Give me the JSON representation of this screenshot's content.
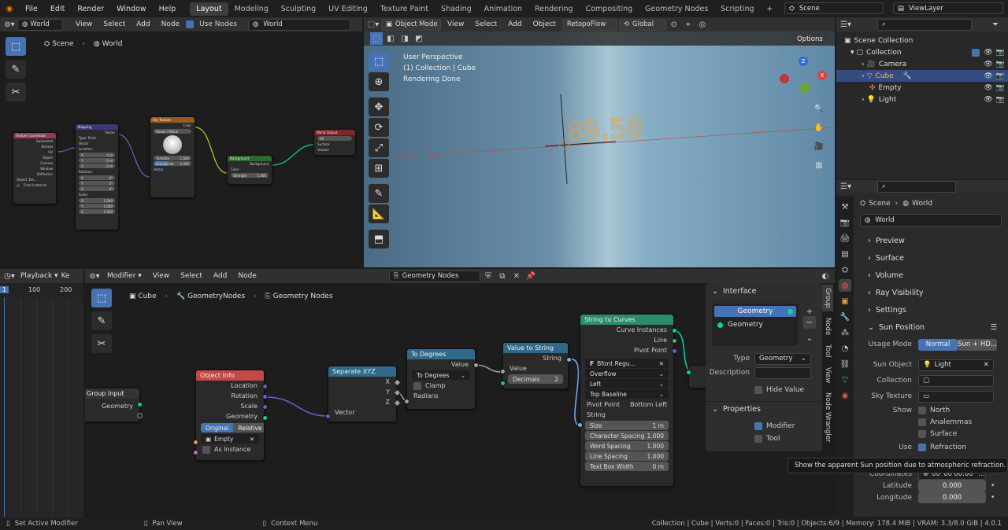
{
  "topbar": {
    "menus": [
      "File",
      "Edit",
      "Render",
      "Window",
      "Help"
    ],
    "workspaces": [
      "Layout",
      "Modeling",
      "Sculpting",
      "UV Editing",
      "Texture Paint",
      "Shading",
      "Animation",
      "Rendering",
      "Compositing",
      "Geometry Nodes",
      "Scripting"
    ],
    "active_workspace": "Layout",
    "scene": "Scene",
    "view_layer": "ViewLayer"
  },
  "world_editor": {
    "type": "World",
    "menus": [
      "View",
      "Select",
      "Add",
      "Node"
    ],
    "use_nodes": "Use Nodes",
    "world": "World",
    "breadcrumb": [
      "Scene",
      "World"
    ],
    "nodes": {
      "texcoord": {
        "title": "Texture Coordinate",
        "outputs": [
          "Generated",
          "Normal",
          "UV",
          "Object",
          "Camera",
          "Window",
          "Reflection"
        ],
        "object": "Object",
        "obj_val": "Em...",
        "from_inst": "From Instancer"
      },
      "mapping": {
        "title": "Mapping",
        "out": "Vector",
        "type": "Type:",
        "type_val": "Point",
        "vector": "Vector",
        "location": "Location:",
        "loc": [
          "X",
          "Y",
          "Z"
        ],
        "loc_vals": [
          "0 m",
          "0 m",
          "0 m"
        ],
        "rotation": "Rotation:",
        "rot_vals": [
          "0°",
          "0°",
          "0°"
        ],
        "scale": "Scale:",
        "scl_vals": [
          "1.000",
          "1.000",
          "1.000"
        ]
      },
      "sky": {
        "title": "Sky Texture",
        "out": "Color",
        "mode": "Hosek / Wilkie",
        "turbidity": "Turbidity",
        "turb_val": "1.000",
        "ground": "Ground Alb.",
        "ground_val": "0.390",
        "vector": "Vector"
      },
      "background": {
        "title": "Background",
        "out": "Background",
        "color": "Color",
        "strength": "Strength",
        "strength_val": "1.000"
      },
      "output": {
        "title": "World Output",
        "target": "All",
        "surface": "Surface",
        "volume": "Volume"
      }
    }
  },
  "viewport": {
    "mode": "Object Mode",
    "menus": [
      "View",
      "Select",
      "Add",
      "Object"
    ],
    "addon": "RetopoFlow",
    "orientation": "Global",
    "options": "Options",
    "info": [
      "User Perspective",
      "(1) Collection | Cube",
      "Rendering Done"
    ],
    "text_object": "89.58"
  },
  "outliner": {
    "root": "Scene Collection",
    "collection": "Collection",
    "items": [
      "Camera",
      "Cube",
      "Empty",
      "Light"
    ]
  },
  "properties": {
    "breadcrumb": [
      "Scene",
      "World"
    ],
    "world": "World",
    "sections": [
      "Preview",
      "Surface",
      "Volume",
      "Ray Visibility",
      "Settings"
    ],
    "sun_position": "Sun Position",
    "usage_mode": "Usage Mode",
    "usage_opts": [
      "Normal",
      "Sun + HD..."
    ],
    "sun_object": "Sun Object",
    "sun_object_val": "Light",
    "collection": "Collection",
    "sky_texture": "Sky Texture",
    "show": "Show",
    "show_opts": [
      "North",
      "Analemmas",
      "Surface"
    ],
    "use": "Use",
    "refraction": "Refraction",
    "tooltip": "Show the apparent Sun position due to atmospheric refraction.",
    "coordinates": "Coordinates",
    "coord_val": "00°00'00.00\" ...",
    "latitude": "Latitude",
    "lat_val": "0.000",
    "longitude": "Longitude",
    "lon_val": "0.000"
  },
  "timeline": {
    "playback": "Playback",
    "keying": "Ke",
    "frames": [
      "1",
      "100",
      "200"
    ]
  },
  "geo_editor": {
    "editor": "Modifier",
    "menus": [
      "View",
      "Select",
      "Add",
      "Node"
    ],
    "tree": "Geometry Nodes",
    "breadcrumb": [
      "Cube",
      "GeometryNodes",
      "Geometry Nodes"
    ],
    "nodes": {
      "group_input": {
        "title": "Group Input",
        "out": "Geometry"
      },
      "object_info": {
        "title": "Object Info",
        "outputs": [
          "Location",
          "Rotation",
          "Scale",
          "Geometry"
        ],
        "modes": [
          "Original",
          "Relative"
        ],
        "object": "Empty",
        "as_instance": "As Instance"
      },
      "separate": {
        "title": "Separate XYZ",
        "outputs": [
          "X",
          "Y",
          "Z"
        ],
        "input": "Vector"
      },
      "to_degrees": {
        "title": "To Degrees",
        "out": "Value",
        "op": "To Degrees",
        "clamp": "Clamp",
        "input": "Radians"
      },
      "value_to_string": {
        "title": "Value to String",
        "out": "String",
        "value": "Value",
        "decimals": "Decimals",
        "decimals_val": "2"
      },
      "string_to_curves": {
        "title": "String to Curves",
        "outputs": [
          "Curve Instances",
          "Line",
          "Pivot Point"
        ],
        "font": "Bfont Regu...",
        "overflow": "Overflow",
        "align": "Left",
        "baseline": "Top Baseline",
        "pivot": "Pivot Point",
        "pivot_val": "Bottom Left",
        "string": "String",
        "fields": [
          [
            "Size",
            "1 m"
          ],
          [
            "Character Spacing",
            "1.000"
          ],
          [
            "Word Spacing",
            "1.000"
          ],
          [
            "Line Spacing",
            "1.000"
          ],
          [
            "Text Box Width",
            "0 m"
          ]
        ]
      }
    }
  },
  "sidebar": {
    "interface": "Interface",
    "geo_item": "Geometry",
    "geo_item2": "Geometry",
    "type": "Type",
    "type_val": "Geometry",
    "description": "Description",
    "hide_value": "Hide Value",
    "properties": "Properties",
    "modifier": "Modifier",
    "tool": "Tool",
    "tabs": [
      "Group",
      "Node",
      "Tool",
      "View",
      "Node Wrangler"
    ]
  },
  "statusbar": {
    "left": [
      "Set Active Modifier",
      "Pan View",
      "Context Menu"
    ],
    "right": "Collection | Cube | Verts:0 | Faces:0 | Tris:0 | Objects:6/9 | Memory: 178.4 MiB | VRAM: 3.3/8.0 GiB | 4.0.1"
  },
  "colors": {
    "accent": "#4772b3",
    "geo_socket": "#00d6a3",
    "vector_socket": "#6363c7",
    "float_socket": "#a1a1a1",
    "string_socket": "#70b2ff"
  }
}
